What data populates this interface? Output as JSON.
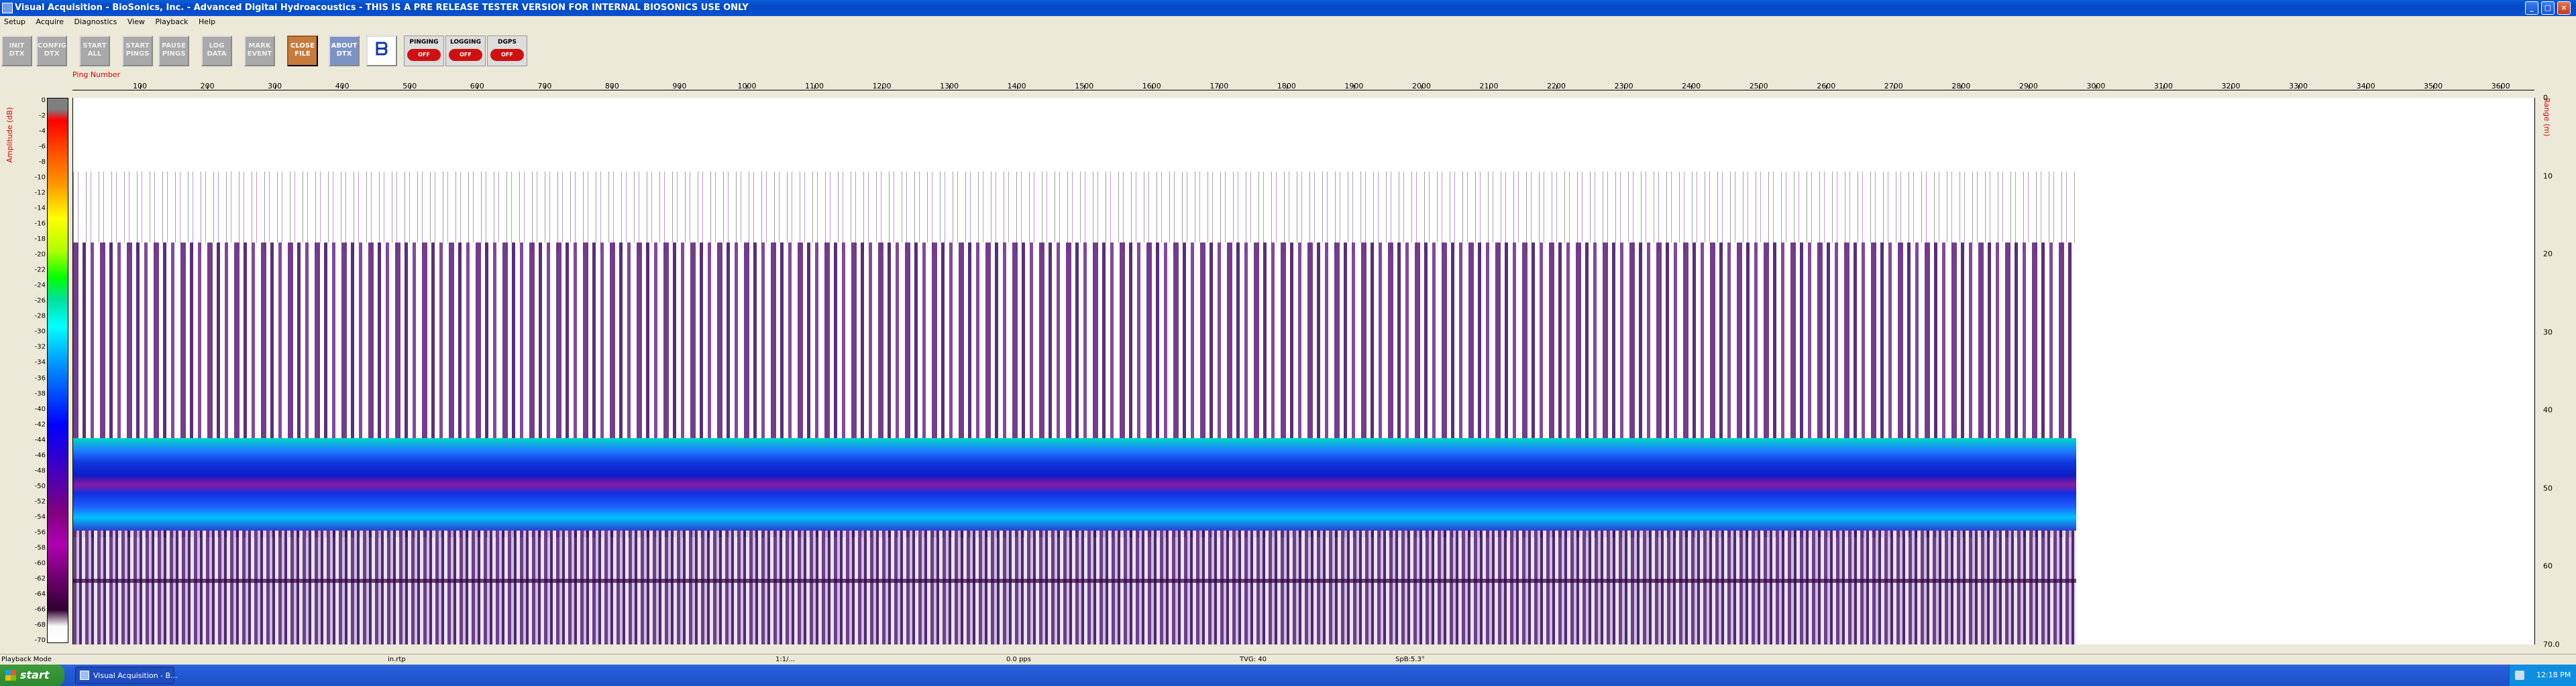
{
  "window": {
    "title": "Visual Acquisition  -  BioSonics, Inc.  -  Advanced Digital Hydroacoustics  -  THIS IS A PRE RELEASE TESTER VERSION FOR INTERNAL BIOSONICS USE ONLY",
    "minimize": "_",
    "maximize": "□",
    "close": "×"
  },
  "menu": [
    "Setup",
    "Acquire",
    "Diagnostics",
    "View",
    "Playback",
    "Help"
  ],
  "toolbar": {
    "buttons": [
      {
        "label": "INIT DTX",
        "icon": "init-dtx-icon"
      },
      {
        "label": "CONFIG DTX",
        "icon": "config-dtx-icon"
      },
      {
        "label": "START ALL",
        "icon": "start-all-icon"
      },
      {
        "label": "START PINGS",
        "icon": "start-pings-icon"
      },
      {
        "label": "PAUSE PINGS",
        "icon": "pause-pings-icon"
      },
      {
        "label": "LOG DATA",
        "icon": "log-data-icon"
      },
      {
        "label": "MARK EVENT",
        "icon": "mark-event-icon"
      },
      {
        "label": "CLOSE FILE",
        "icon": "close-file-icon"
      },
      {
        "label": "ABOUT DTX",
        "icon": "about-dtx-icon"
      }
    ],
    "logo": "ᗷ",
    "indicators": [
      {
        "label": "PINGING",
        "state": "OFF"
      },
      {
        "label": "LOGGING",
        "state": "OFF"
      },
      {
        "label": "DGPS",
        "state": "OFF"
      }
    ]
  },
  "echogram": {
    "x_axis_label": "Ping Number",
    "x_ticks": [
      "100",
      "200",
      "300",
      "400",
      "500",
      "600",
      "700",
      "800",
      "900",
      "1000",
      "1100",
      "1200",
      "1300",
      "1400",
      "1500",
      "1600",
      "1700",
      "1800",
      "1900",
      "2000",
      "2100",
      "2200",
      "2300",
      "2400",
      "2500",
      "2600",
      "2700",
      "2800",
      "2900",
      "3000",
      "3100",
      "3200",
      "3300",
      "3400",
      "3500",
      "3600"
    ],
    "x_max": 3650,
    "data_pings": 2970,
    "amplitude_label": "Amplitude (dB)",
    "amplitude_ticks": [
      "0",
      "-2",
      "-4",
      "-6",
      "-8",
      "-10",
      "-12",
      "-14",
      "-16",
      "-18",
      "-20",
      "-22",
      "-24",
      "-26",
      "-28",
      "-30",
      "-32",
      "-34",
      "-36",
      "-38",
      "-40",
      "-42",
      "-44",
      "-46",
      "-48",
      "-50",
      "-52",
      "-54",
      "-56",
      "-58",
      "-60",
      "-62",
      "-64",
      "-66",
      "-68",
      "-70"
    ],
    "range_label": "Range (m)",
    "range_ticks": [
      "0",
      "10",
      "20",
      "30",
      "40",
      "50",
      "60",
      "70.0"
    ],
    "range_max": 70,
    "colors": {
      "band_cyan": "#00d8c8",
      "band_blue": "#1038e0",
      "noise_purple": "#5a1a78",
      "axis_red": "#e00000"
    }
  },
  "statusbar": {
    "mode": "Playback Mode",
    "file": "in.rtp",
    "time": "1:1/...",
    "rate": "0.0 pps",
    "tvg": "TVG: 40",
    "sp": "SpB:5.3°"
  },
  "taskbar": {
    "start": "start",
    "task": "Visual Acquisition - B...",
    "clock": "12:18 PM"
  }
}
